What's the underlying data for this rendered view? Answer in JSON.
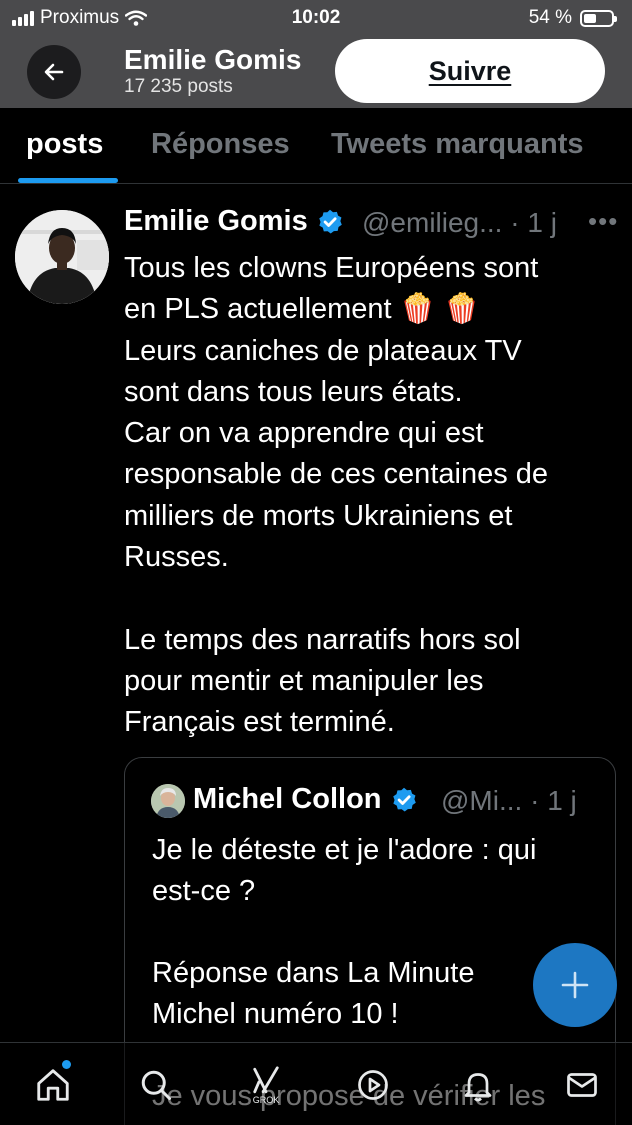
{
  "status_bar": {
    "carrier": "Proximus",
    "time": "10:02",
    "battery_percent": "54 %",
    "battery_level": 0.54
  },
  "header": {
    "back_icon": "arrow-left-icon",
    "name": "Emilie Gomis",
    "post_count": "17 235 posts",
    "follow_label": "Suivre"
  },
  "tabs": [
    {
      "label": "posts",
      "active": true
    },
    {
      "label": "Réponses",
      "active": false
    },
    {
      "label": "Tweets marquants",
      "active": false
    }
  ],
  "tweet": {
    "author_name": "Emilie Gomis",
    "handle": "@emilieg...",
    "time": "· 1 j",
    "more_icon": "more-horizontal-icon",
    "text": "Tous les clowns Européens sont\nen PLS actuellement 🍿 🍿\nLeurs caniches de plateaux TV\nsont dans tous leurs états.\nCar on va apprendre qui est\nresponsable de ces centaines de\nmilliers de morts Ukrainiens et\nRusses.\n\nLe temps des narratifs hors sol\npour mentir et manipuler les\nFrançais est terminé.",
    "quoted": {
      "author_name": "Michel Collon",
      "handle": "@Mi...",
      "time": "· 1 j",
      "text": "Je le déteste et je l'adore : qui\nest-ce ?\n\nRéponse dans La Minute\nMichel numéro 10 !\n\nJe vous propose de vérifier les"
    }
  },
  "bottom_nav": {
    "items": [
      "home-icon",
      "search-icon",
      "grok-icon",
      "video-icon",
      "notifications-icon",
      "messages-icon"
    ],
    "grok_label": "GROK"
  },
  "colors": {
    "accent": "#1d9bf0",
    "verified": "#1d9bf0",
    "fab": "#1d77c2",
    "header_bg": "#4a4a4c"
  }
}
